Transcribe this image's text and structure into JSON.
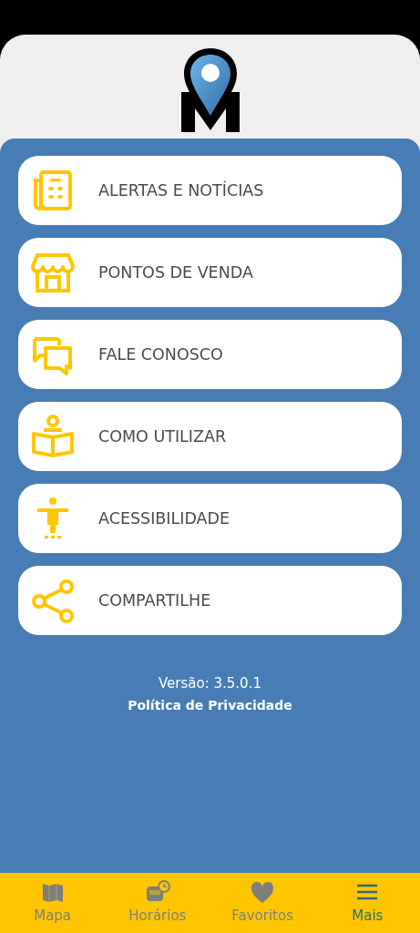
{
  "menu": [
    {
      "kind": "newspaper",
      "label": "ALERTAS E NOTÍCIAS"
    },
    {
      "kind": "store",
      "label": "PONTOS DE VENDA"
    },
    {
      "kind": "chat",
      "label": "FALE CONOSCO"
    },
    {
      "kind": "reader",
      "label": "COMO UTILIZAR"
    },
    {
      "kind": "accessibility",
      "label": "ACESSIBILIDADE"
    },
    {
      "kind": "share",
      "label": "COMPARTILHE"
    }
  ],
  "version": "Versão: 3.5.0.1",
  "privacy_link": "Política de Privacidade",
  "tabs": [
    {
      "kind": "map",
      "label": "Mapa",
      "selected": false
    },
    {
      "kind": "schedule",
      "label": "Horários",
      "selected": false
    },
    {
      "kind": "heart",
      "label": "Favoritos",
      "selected": false
    },
    {
      "kind": "menu",
      "label": "Mais",
      "selected": true
    }
  ]
}
